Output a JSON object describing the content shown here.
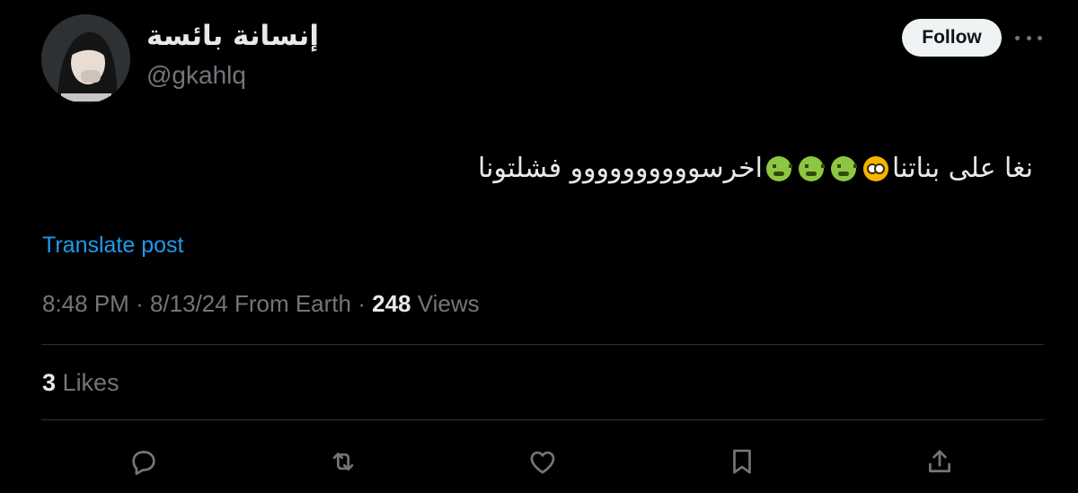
{
  "author": {
    "display_name": "إنسانة بائسة",
    "handle": "@gkahlq",
    "avatar_icon": "user-avatar-photo"
  },
  "header": {
    "follow_label": "Follow",
    "more_icon": "more-horizontal-icon"
  },
  "tweet": {
    "text_part1": "نغا على بناتنا",
    "text_part2": "اخرسوووووووووو فشلتونا",
    "emojis": [
      "flushed-face",
      "nauseated-face",
      "nauseated-face",
      "nauseated-face"
    ]
  },
  "translate_label": "Translate post",
  "meta": {
    "time": "8:48 PM",
    "date": "8/13/24",
    "source": "From Earth",
    "views_count": "248",
    "views_label": "Views",
    "sep": "·"
  },
  "stats": {
    "likes_count": "3",
    "likes_label": "Likes"
  },
  "actions": [
    "reply-icon",
    "retweet-icon",
    "like-icon",
    "bookmark-icon",
    "share-icon"
  ],
  "colors": {
    "background": "#000000",
    "text": "#e7e9ea",
    "secondary": "#71767b",
    "link": "#1d9bf0",
    "divider": "#2f3336"
  }
}
